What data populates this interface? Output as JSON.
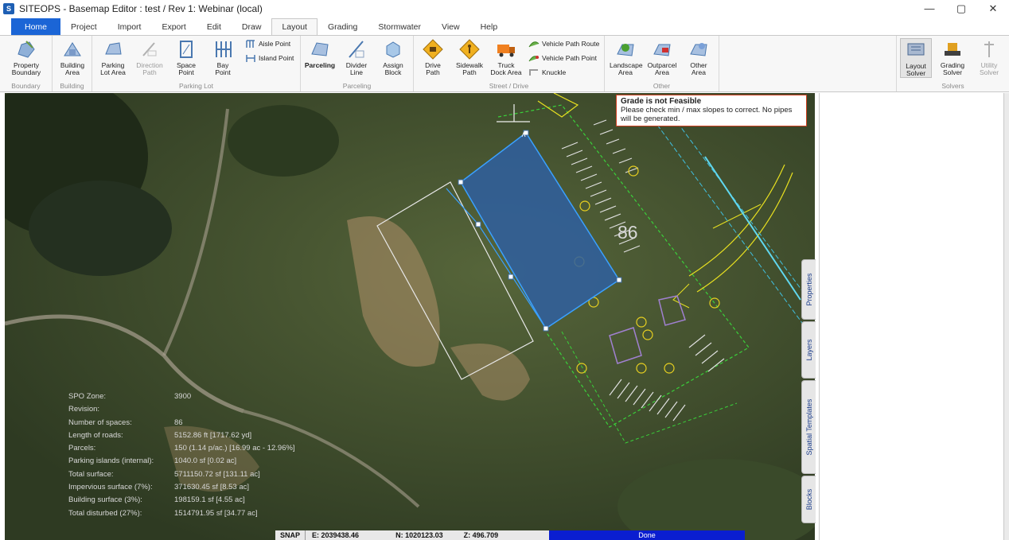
{
  "window": {
    "title": "SITEOPS - Basemap Editor : test / Rev 1: Webinar (local)",
    "app_icon": "S",
    "controls": [
      "—",
      "▢",
      "✕"
    ]
  },
  "tabs": [
    "Home",
    "Project",
    "Import",
    "Export",
    "Edit",
    "Draw",
    "Layout",
    "Grading",
    "Stormwater",
    "View",
    "Help"
  ],
  "ribbon": {
    "groups": {
      "boundary": "Boundary",
      "building": "Building",
      "parking": "Parking Lot",
      "parceling": "Parceling",
      "street": "Street / Drive",
      "other": "Other",
      "solvers": "Solvers"
    },
    "buttons": {
      "property_boundary": [
        "Property",
        "Boundary"
      ],
      "building_area": [
        "Building",
        "Area"
      ],
      "parking_lot_area": [
        "Parking",
        "Lot Area"
      ],
      "direction_path": [
        "Direction",
        "Path"
      ],
      "space_point": [
        "Space",
        "Point"
      ],
      "bay_point": [
        "Bay",
        "Point"
      ],
      "aisle_point": "Aisle Point",
      "island_point": "Island Point",
      "parceling": "Parceling",
      "divider_line": [
        "Divider",
        "Line"
      ],
      "assign_block": [
        "Assign",
        "Block"
      ],
      "drive_path": [
        "Drive",
        "Path"
      ],
      "sidewalk_path": [
        "Sidewalk",
        "Path"
      ],
      "truck_dock_area": [
        "Truck",
        "Dock Area"
      ],
      "vehicle_path_route": "Vehicle Path Route",
      "vehicle_path_point": "Vehicle Path Point",
      "knuckle": "Knuckle",
      "landscape_area": [
        "Landscape",
        "Area"
      ],
      "outparcel_area": [
        "Outparcel",
        "Area"
      ],
      "other_area": [
        "Other",
        "Area"
      ],
      "layout_solver": [
        "Layout",
        "Solver"
      ],
      "grading_solver": [
        "Grading",
        "Solver"
      ],
      "utility_solver": [
        "Utility",
        "Solver"
      ]
    }
  },
  "map": {
    "grade_warning": {
      "title": "Grade is not Feasible",
      "message": "Please check min / max slopes to correct. No pipes will be generated."
    },
    "space_count_label": "86",
    "stats": [
      {
        "label": "SPO Zone:",
        "value": "3900"
      },
      {
        "label": "Revision:",
        "value": ""
      },
      {
        "label": "Number of spaces:",
        "value": "86"
      },
      {
        "label": "Length of roads:",
        "value": "5152.86 ft [1717.62 yd]"
      },
      {
        "label": "Parcels:",
        "value": "150 (1.14 p/ac.) [16.99 ac - 12.96%]"
      },
      {
        "label": "Parking islands (internal):",
        "value": "1040.0 sf [0.02 ac]"
      },
      {
        "label": "Total surface:",
        "value": "5711150.72 sf [131.11 ac]"
      },
      {
        "label": "Impervious surface (7%):",
        "value": "371630.45 sf [8.53 ac]"
      },
      {
        "label": "Building surface (3%):",
        "value": "198159.1 sf [4.55 ac]"
      },
      {
        "label": "Total disturbed (27%):",
        "value": "1514791.95 sf [34.77 ac]"
      }
    ]
  },
  "status": {
    "snap": "SNAP",
    "easting": "E: 2039438.46",
    "northing": "N: 1020123.03",
    "elevation": "Z: 496.709",
    "state": "Done"
  },
  "side_tabs": [
    "Properties",
    "Layers",
    "Spatial Templates",
    "Blocks"
  ],
  "colors": {
    "accent": "#1b65d6",
    "building_fill": "#2f5fa0",
    "building_outline": "#3aa0ff",
    "parking_lines": "#c8e050",
    "boundary_green": "#3ad03a",
    "road_yellow": "#e8e020",
    "status_done": "#0a1ed0",
    "warning_border": "#d04020"
  }
}
